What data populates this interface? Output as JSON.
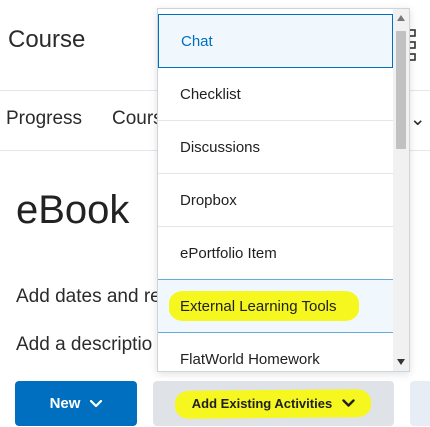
{
  "header": {
    "course_title": "Course"
  },
  "nav": {
    "items": [
      "Progress",
      "Cours",
      "s ⌄"
    ]
  },
  "page": {
    "title": "eBook",
    "dates_line": "Add dates and re",
    "description_line": "Add a descriptio"
  },
  "toolbar": {
    "new_label": "New",
    "add_existing_label": "Add Existing Activities"
  },
  "dropdown": {
    "items": [
      "Chat",
      "Checklist",
      "Discussions",
      "Dropbox",
      "ePortfolio Item",
      "External Learning Tools",
      "FlatWorld Homework"
    ]
  },
  "colors": {
    "primary": "#006fbf",
    "highlighter": "#f5f71e",
    "selected_bg": "#f0f8fd",
    "secondary_button": "#dfe3e8"
  }
}
